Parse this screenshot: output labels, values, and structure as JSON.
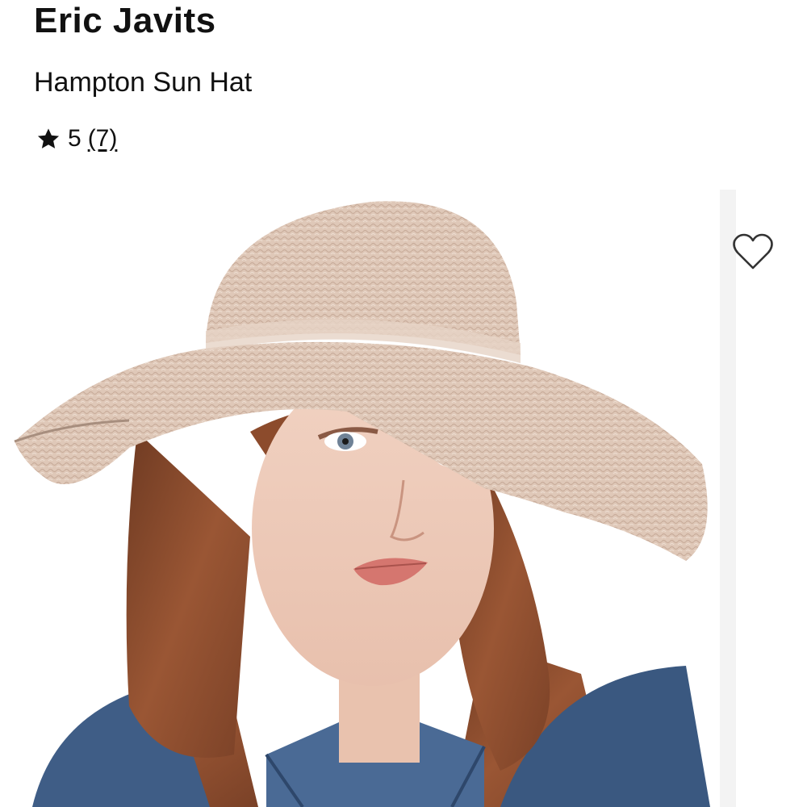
{
  "product": {
    "brand": "Eric Javits",
    "name": "Hampton Sun Hat",
    "rating": "5",
    "review_count": "(7)"
  },
  "image": {
    "icon_wishlist": "heart-outline-icon",
    "icon_star": "star-icon"
  },
  "colors": {
    "text": "#111111",
    "scroll_track": "#f3f3f3",
    "hat": "#dcc6b6",
    "hair": "#8a4b2c",
    "denim": "#3d5a83"
  }
}
